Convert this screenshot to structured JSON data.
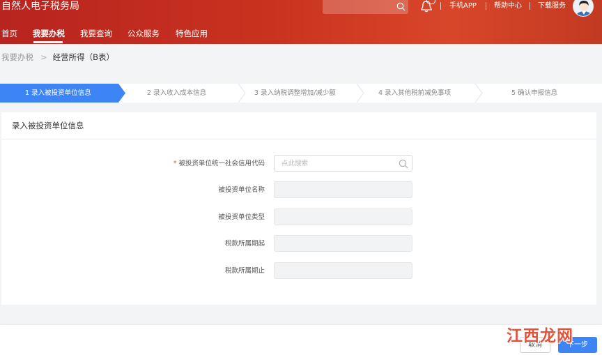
{
  "header": {
    "app_title": "自然人电子税务局",
    "search": {
      "placeholder": ""
    },
    "notification_badge": "",
    "links": [
      "手机APP",
      "帮助中心",
      "下载服务"
    ]
  },
  "nav": {
    "items": [
      "首页",
      "我要办税",
      "我要查询",
      "公众服务",
      "特色应用"
    ],
    "active_index": 1
  },
  "breadcrumb": {
    "parent": "我要办税",
    "separator": ">",
    "current": "经营所得（B表）"
  },
  "steps": [
    {
      "label": "1  录入被投资单位信息",
      "active": true
    },
    {
      "label": "2  录入收入成本信息",
      "active": false
    },
    {
      "label": "3  录入纳税调整增加/减少额",
      "active": false
    },
    {
      "label": "4  录入其他税前减免事项",
      "active": false
    },
    {
      "label": "5  确认申报信息",
      "active": false
    }
  ],
  "form": {
    "title": "录入被投资单位信息",
    "fields": [
      {
        "label": "被投资单位统一社会信用代码",
        "required_mark": "*",
        "placeholder": "点此搜索",
        "value": ""
      },
      {
        "label": "被投资单位名称",
        "value": ""
      },
      {
        "label": "被投资单位类型",
        "value": ""
      },
      {
        "label": "税款所属期起",
        "value": ""
      },
      {
        "label": "税款所属期止",
        "value": ""
      }
    ]
  },
  "footer": {
    "cancel_label": "取消",
    "next_label": "下一步"
  },
  "watermark": {
    "text": "江西龙网"
  },
  "colors": {
    "header_red": "#c8331f",
    "step_active_blue": "#3d84f5",
    "primary_button": "#3d84f5",
    "required_mark": "#e8552c",
    "watermark": "#e2533b"
  },
  "icons": {
    "header_search": "search-icon",
    "notification": "bell-icon",
    "avatar": "user-avatar",
    "field_search": "search-icon"
  }
}
